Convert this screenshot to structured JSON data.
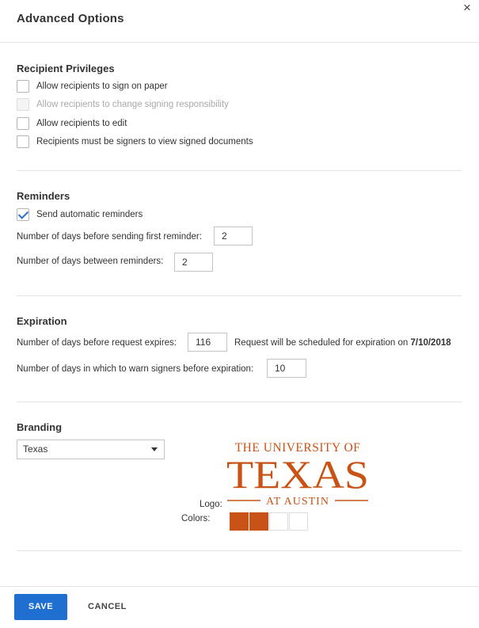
{
  "dialog": {
    "title": "Advanced Options",
    "close_glyph": "×"
  },
  "recipient_privileges": {
    "title": "Recipient Privileges",
    "options": [
      {
        "label": "Allow recipients to sign on paper",
        "checked": false,
        "disabled": false
      },
      {
        "label": "Allow recipients to change signing responsibility",
        "checked": false,
        "disabled": true
      },
      {
        "label": "Allow recipients to edit",
        "checked": false,
        "disabled": false
      },
      {
        "label": "Recipients must be signers to view signed documents",
        "checked": false,
        "disabled": false
      }
    ]
  },
  "reminders": {
    "title": "Reminders",
    "send_auto_label": "Send automatic reminders",
    "send_auto_checked": true,
    "first_reminder_label": "Number of days before sending first reminder:",
    "first_reminder_value": "2",
    "between_label": "Number of days between reminders:",
    "between_value": "2"
  },
  "expiration": {
    "title": "Expiration",
    "expires_label": "Number of days before request expires:",
    "expires_value": "116",
    "scheduled_text": "Request will be scheduled for expiration on",
    "scheduled_date": "7/10/2018",
    "warn_label": "Number of days in which to warn signers before expiration:",
    "warn_value": "10"
  },
  "branding": {
    "title": "Branding",
    "selected": "Texas",
    "logo_label": "Logo:",
    "colors_label": "Colors:",
    "logo_text": {
      "line1": "THE UNIVERSITY OF",
      "line2": "TEXAS",
      "line3": "AT AUSTIN"
    },
    "colors": [
      "#c95316",
      "#c95316",
      "#ffffff",
      "#ffffff"
    ]
  },
  "footer": {
    "save_label": "SAVE",
    "cancel_label": "CANCEL"
  },
  "theme": {
    "accent": "#1f6fd0",
    "brand_orange": "#c95316"
  }
}
